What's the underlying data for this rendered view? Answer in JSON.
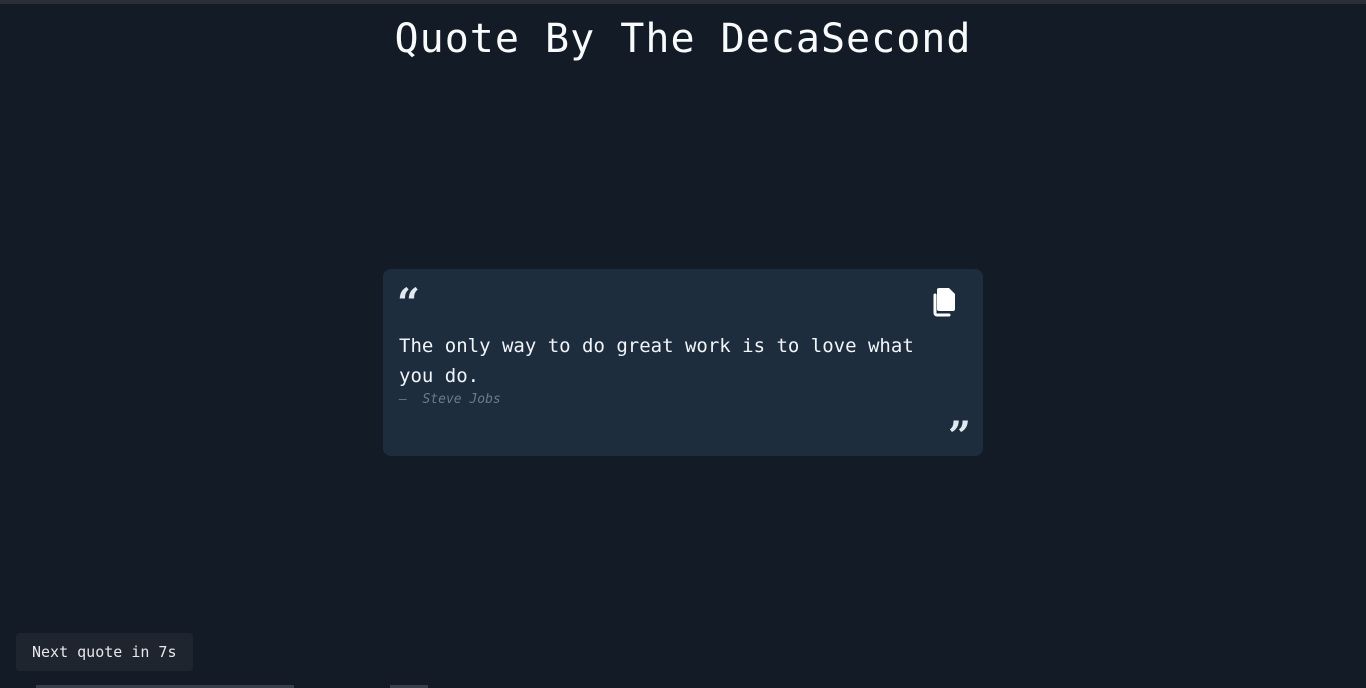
{
  "header": {
    "title": "Quote By The DecaSecond"
  },
  "quote": {
    "open_mark": "“",
    "close_mark": "”",
    "text": "The only way to do great work is to love what you do.",
    "author": "—  Steve Jobs",
    "copy_icon": "copy-icon"
  },
  "timer": {
    "label": "Next quote in 7s"
  },
  "colors": {
    "background": "#131c26",
    "card": "#1e2d3d",
    "text": "#f1f5f9",
    "author": "#6b7a8c"
  }
}
